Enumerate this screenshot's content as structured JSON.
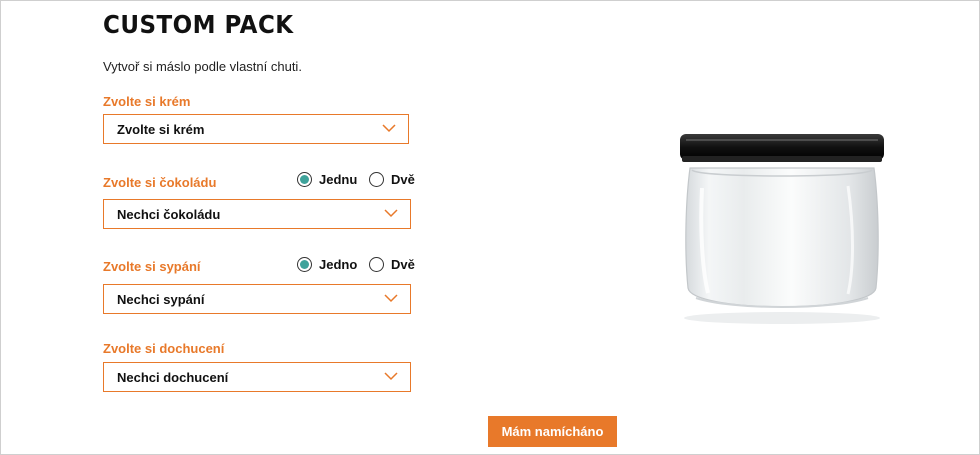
{
  "header": {
    "title": "CUSTOM PACK",
    "subtitle": "Vytvoř si máslo podle vlastní chuti."
  },
  "fields": {
    "cream": {
      "label": "Zvolte si krém",
      "selected": "Zvolte si krém"
    },
    "chocolate": {
      "label": "Zvolte si čokoládu",
      "selected": "Nechci čokoládu",
      "options": [
        {
          "label": "Jednu",
          "checked": true
        },
        {
          "label": "Dvě",
          "checked": false
        }
      ]
    },
    "topping": {
      "label": "Zvolte si sypání",
      "selected": "Nechci sypání",
      "options": [
        {
          "label": "Jedno",
          "checked": true
        },
        {
          "label": "Dvě",
          "checked": false
        }
      ]
    },
    "seasoning": {
      "label": "Zvolte si dochucení",
      "selected": "Nechci dochucení"
    }
  },
  "actions": {
    "submit_label": "Mám namícháno"
  },
  "colors": {
    "accent": "#e8792a",
    "radio_checked": "#3fa39b"
  },
  "icons": {
    "select_arrow": "chevron-down-icon",
    "product_image": "glass-jar-image"
  }
}
